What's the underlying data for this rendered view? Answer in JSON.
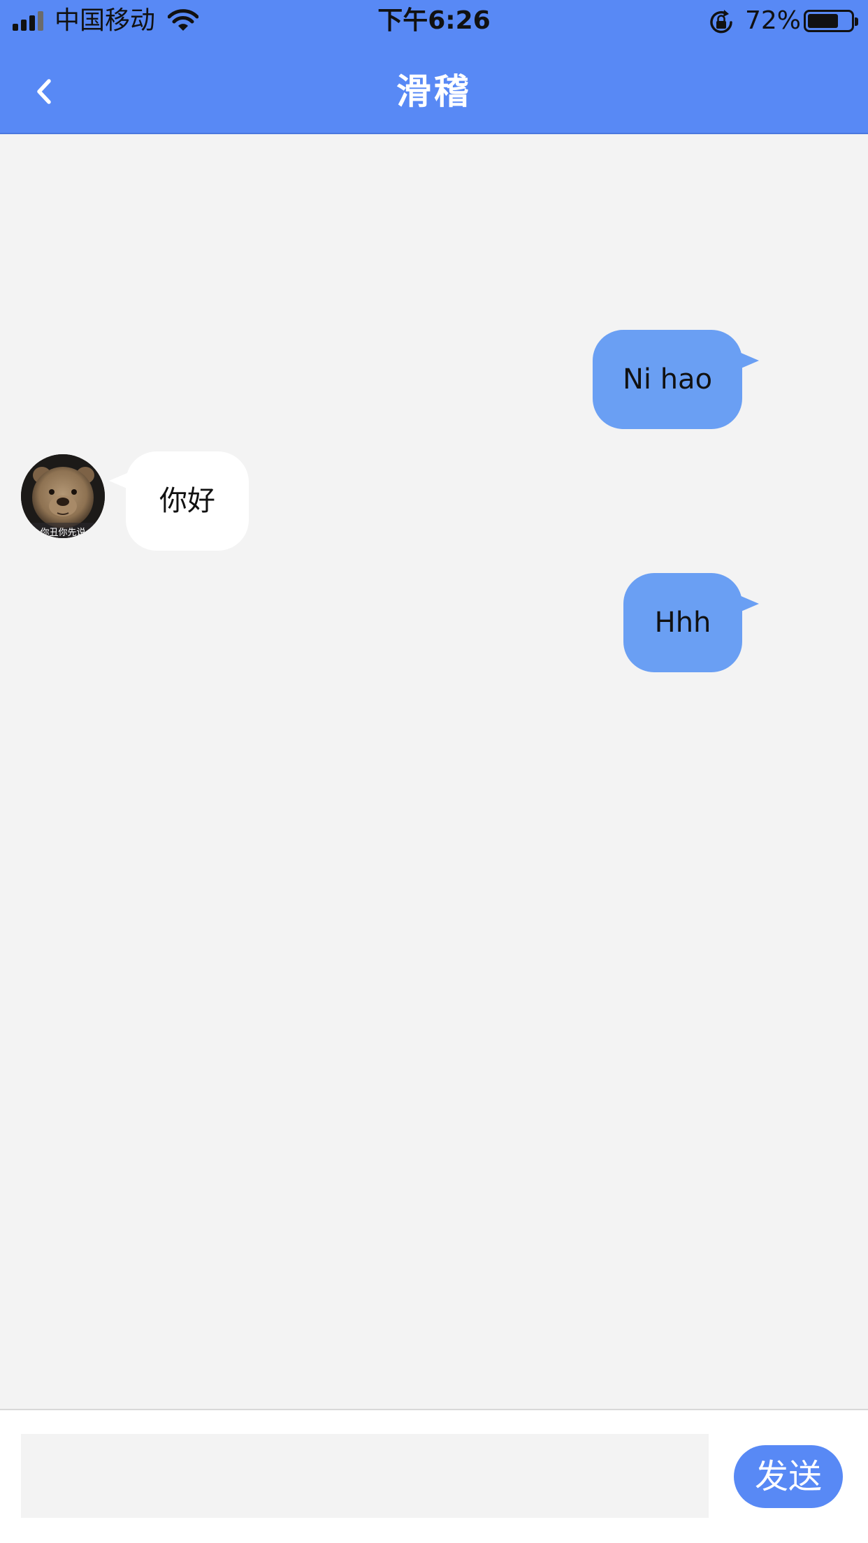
{
  "status_bar": {
    "carrier": "中国移动",
    "time": "下午6:26",
    "battery_percent": "72%",
    "battery_level": 0.72,
    "icons": [
      "signal-icon",
      "wifi-icon",
      "rotation-lock-icon",
      "battery-icon"
    ]
  },
  "header": {
    "title": "滑稽",
    "back_icon": "chevron-left-icon",
    "background_color": "#5889f5"
  },
  "messages": [
    {
      "side": "out",
      "text": "Ni hao"
    },
    {
      "side": "in",
      "text": "你好",
      "avatar_caption": "你丑你先说"
    },
    {
      "side": "out",
      "text": "Hhh"
    }
  ],
  "composer": {
    "input_value": "",
    "send_label": "发送"
  },
  "colors": {
    "accent": "#5889f5",
    "outgoing_bubble": "#6a9ff3",
    "incoming_bubble": "#ffffff",
    "chat_background": "#f3f3f3"
  }
}
